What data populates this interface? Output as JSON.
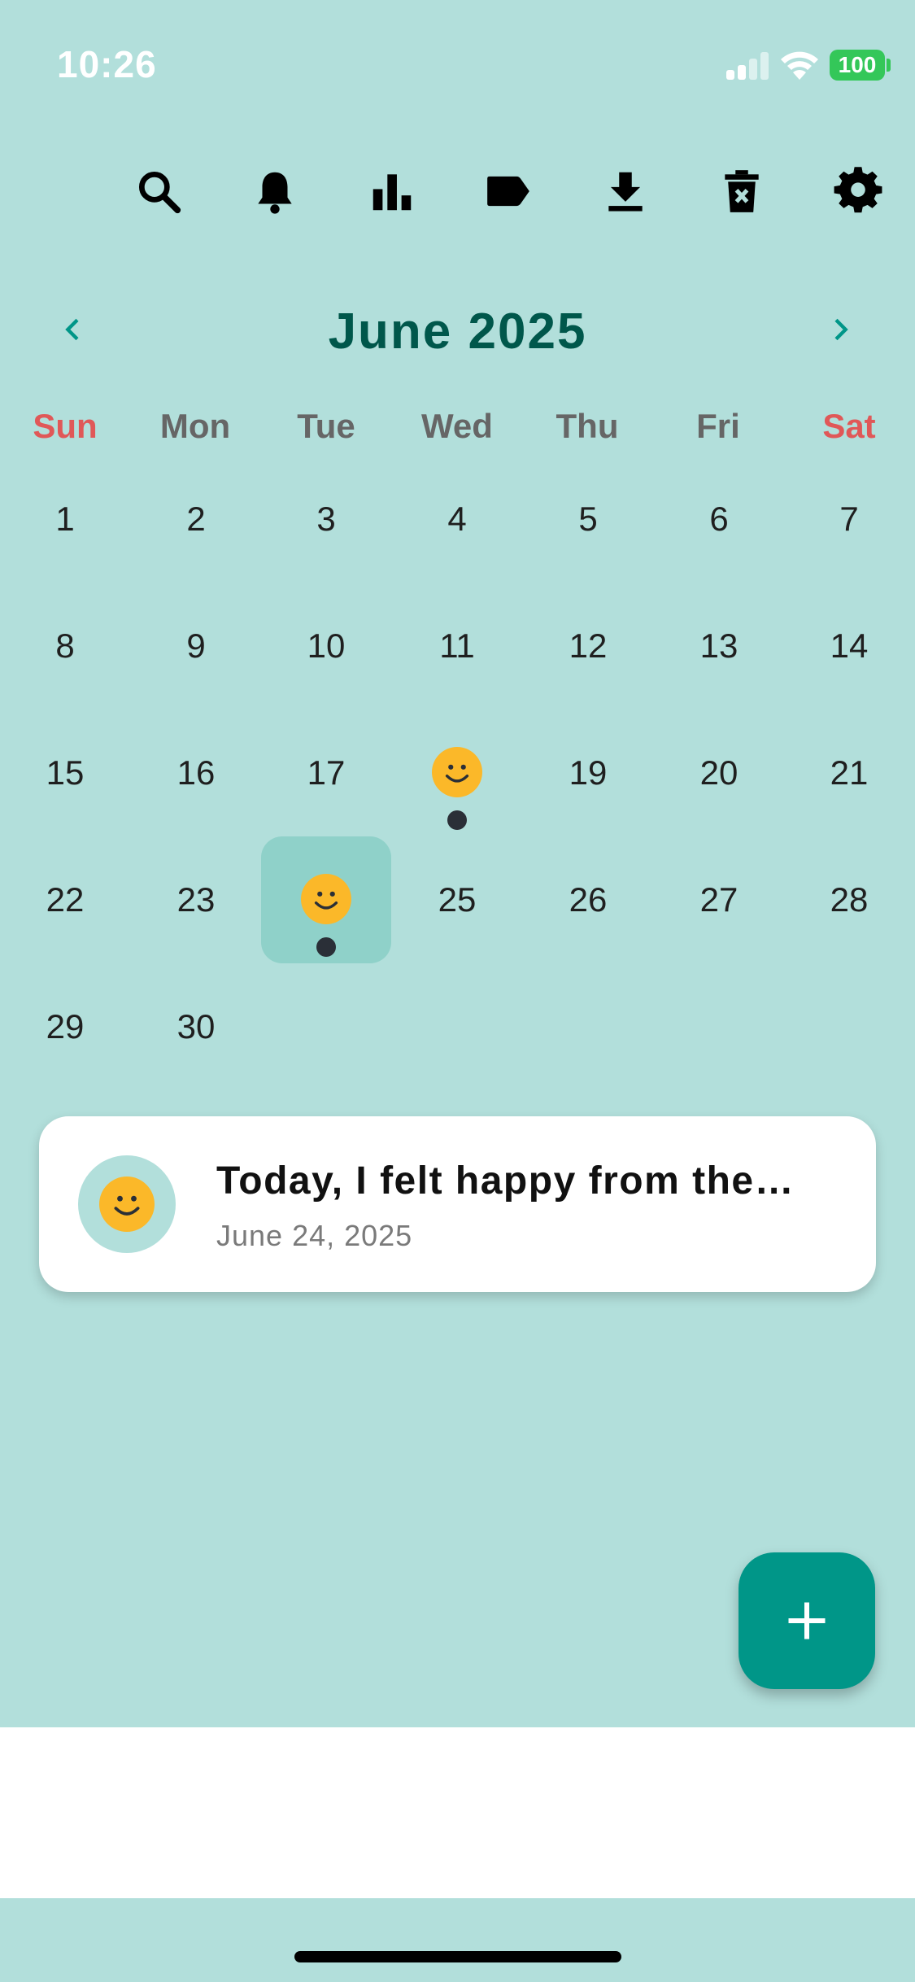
{
  "status_bar": {
    "time": "10:26",
    "battery": "100"
  },
  "toolbar": {
    "icons": [
      "search-icon",
      "bell-icon",
      "bar-chart-icon",
      "label-tag-icon",
      "download-icon",
      "delete-icon",
      "gear-icon"
    ]
  },
  "calendar": {
    "month_title": "June 2025",
    "weekdays": [
      "Sun",
      "Mon",
      "Tue",
      "Wed",
      "Thu",
      "Fri",
      "Sat"
    ],
    "days": [
      "1",
      "2",
      "3",
      "4",
      "5",
      "6",
      "7",
      "8",
      "9",
      "10",
      "11",
      "12",
      "13",
      "14",
      "15",
      "16",
      "17",
      "18",
      "19",
      "20",
      "21",
      "22",
      "23",
      "24",
      "25",
      "26",
      "27",
      "28",
      "29",
      "30"
    ],
    "mood_days": [
      "18",
      "24"
    ],
    "selected_day": "24"
  },
  "entry": {
    "title": "Today, I felt happy from the…",
    "date": "June 24, 2025"
  },
  "colors": {
    "background": "#b2dfdb",
    "accent": "#009688",
    "title": "#00574b",
    "weekend": "#e05858",
    "mood": "#fbb829"
  }
}
